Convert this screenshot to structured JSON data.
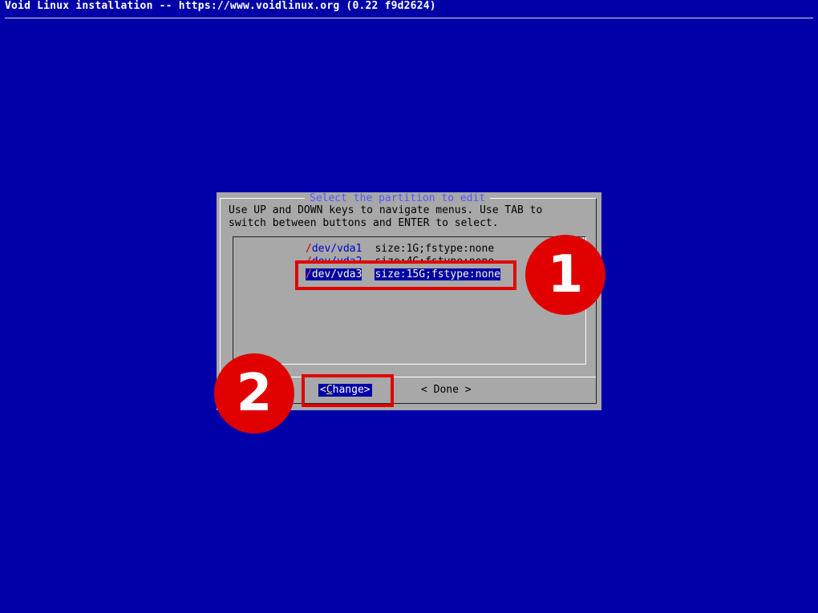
{
  "header": {
    "title": "Void Linux installation -- https://www.voidlinux.org (0.22 f9d2624)"
  },
  "dialog": {
    "title": "Select the partition to edit",
    "prompt_line1": "Use UP and DOWN keys to navigate menus. Use TAB to",
    "prompt_line2": "switch between buttons and ENTER to select.",
    "partitions": [
      {
        "device_slash": "/",
        "device_rest": "dev/vda1",
        "description": "size:1G;fstype:none",
        "selected": false
      },
      {
        "device_slash": "/",
        "device_rest": "dev/vda2",
        "description": "size:4G;fstype:none",
        "selected": false
      },
      {
        "device_slash": "/",
        "device_rest": "dev/vda3",
        "description": "size:15G;fstype:none",
        "selected": true
      }
    ],
    "buttons": {
      "change_open": "<",
      "change_hot": "C",
      "change_rest": "hange>",
      "done": "< Done >"
    }
  },
  "annotations": {
    "badge_1": "1",
    "badge_2": "2",
    "color": "#e00000"
  },
  "colors": {
    "background": "#0000a8",
    "dialog": "#a8a8a8",
    "title_text": "#5555ff"
  }
}
